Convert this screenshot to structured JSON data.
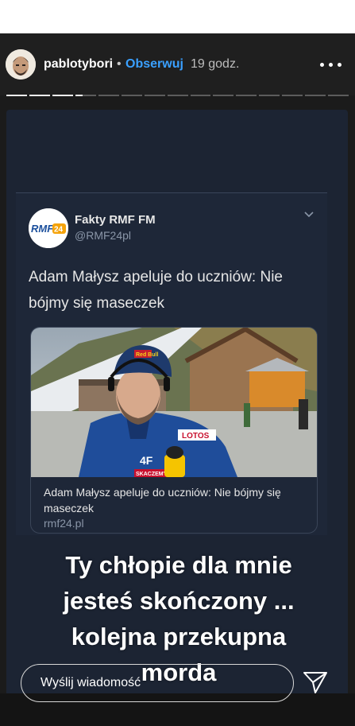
{
  "header": {
    "username": "pablotybori",
    "separator": "•",
    "follow_label": "Obserwuj",
    "time": "19 godz.",
    "more_icon": "more-horizontal-icon"
  },
  "progress": {
    "segments": 15,
    "current_segment": 4,
    "current_progress": 0.35
  },
  "tweet": {
    "account_name": "Fakty RMF FM",
    "account_handle": "@RMF24pl",
    "logo_text": "RMF",
    "logo_badge": "24",
    "text": "Adam Małysz apeluje do uczniów: Nie bójmy się maseczek",
    "card": {
      "title": "Adam Małysz apeluje do uczniów: Nie bójmy się maseczek",
      "link": "rmf24.pl",
      "photo_texts": {
        "cap_brand": "Red Bull",
        "sponsor1": "LOTOS",
        "sponsor2": "4F",
        "sponsor3": "SKACZEMY"
      }
    }
  },
  "caption": {
    "lines": [
      "Ty chłopie dla mnie",
      "jesteś skończony ...",
      "kolejna przekupna",
      "morda"
    ]
  },
  "reply": {
    "placeholder": "Wyślij wiadomość",
    "send_icon": "send-direct-icon"
  },
  "colors": {
    "follow": "#3aa0ff",
    "story_bg": "#1c2433",
    "rmf_orange": "#f5a30a",
    "rmf_blue": "#1b4f9c"
  }
}
